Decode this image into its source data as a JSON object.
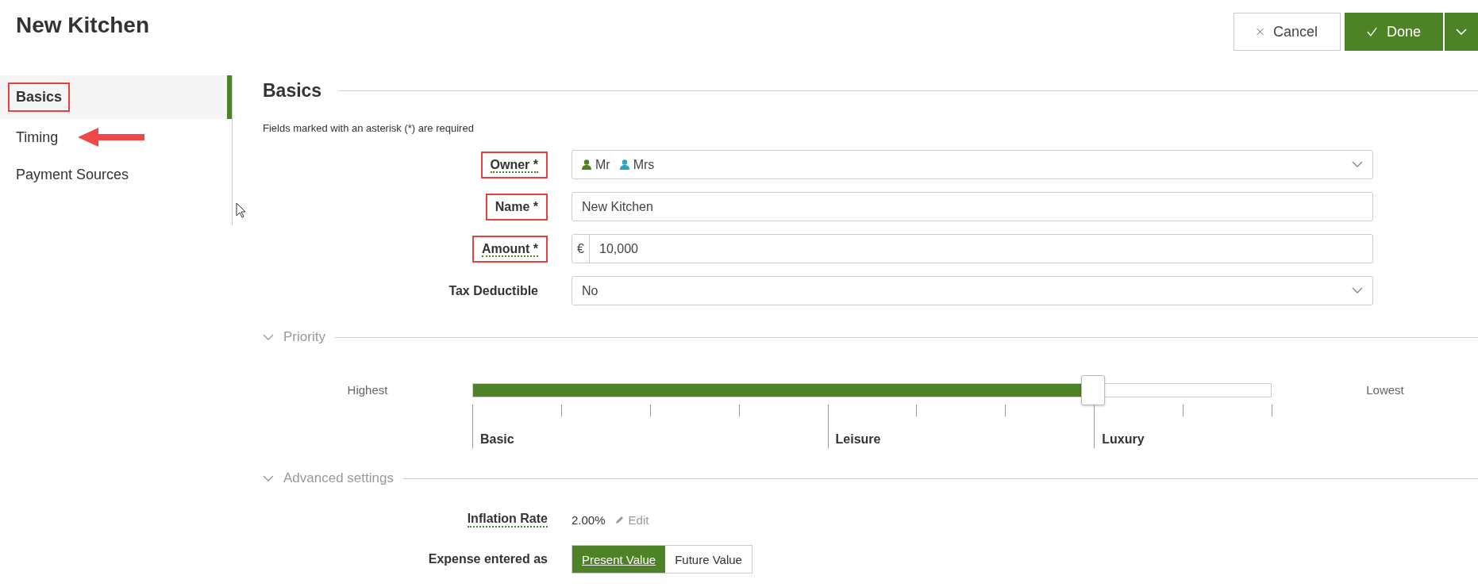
{
  "header": {
    "title": "New Kitchen",
    "buttons": [
      {
        "kind": "cancel",
        "label": "Cancel"
      },
      {
        "kind": "done",
        "label": "Done"
      },
      {
        "kind": "menu"
      }
    ]
  },
  "sidebar": {
    "items": [
      {
        "label": "Basics",
        "selected": true,
        "highlighted": true,
        "arrow": false
      },
      {
        "label": "Timing",
        "selected": false,
        "highlighted": false,
        "arrow": true
      },
      {
        "label": "Payment Sources",
        "selected": false,
        "highlighted": false,
        "arrow": false
      }
    ]
  },
  "section": {
    "title": "Basics",
    "note": "Fields marked with an asterisk (*) are required"
  },
  "fields": [
    {
      "kind": "owners",
      "label": "Owner *",
      "highlighted": true,
      "has_tooltip": true,
      "owners": [
        {
          "name": "Mr",
          "color": "#4e8226"
        },
        {
          "name": "Mrs",
          "color": "#2aa6c0"
        }
      ]
    },
    {
      "kind": "text",
      "label": "Name *",
      "highlighted": true,
      "has_tooltip": false,
      "value": "New Kitchen"
    },
    {
      "kind": "currency",
      "label": "Amount *",
      "highlighted": true,
      "has_tooltip": true,
      "prefix": "€",
      "value": "10,000"
    },
    {
      "kind": "select",
      "label": "Tax Deductible",
      "highlighted": false,
      "has_tooltip": false,
      "value": "No"
    }
  ],
  "priority": {
    "title": "Priority",
    "expanded": true,
    "min_label": "Highest",
    "max_label": "Lowest",
    "level": 0.777,
    "ticks": [
      {
        "major": true,
        "label": "Basic"
      },
      {
        "major": false
      },
      {
        "major": false
      },
      {
        "major": false
      },
      {
        "major": true,
        "label": "Leisure"
      },
      {
        "major": false
      },
      {
        "major": false
      },
      {
        "major": true,
        "label": "Luxury"
      },
      {
        "major": false
      },
      {
        "major": false
      }
    ]
  },
  "advanced": {
    "title": "Advanced settings",
    "expanded": true,
    "inflation": {
      "label": "Inflation Rate",
      "has_tooltip": true,
      "value": "2.00%",
      "action": "Edit"
    },
    "expense": {
      "label": "Expense entered as",
      "has_tooltip": false,
      "options": [
        {
          "label": "Present Value",
          "selected": true
        },
        {
          "label": "Future Value",
          "selected": false
        }
      ]
    }
  }
}
